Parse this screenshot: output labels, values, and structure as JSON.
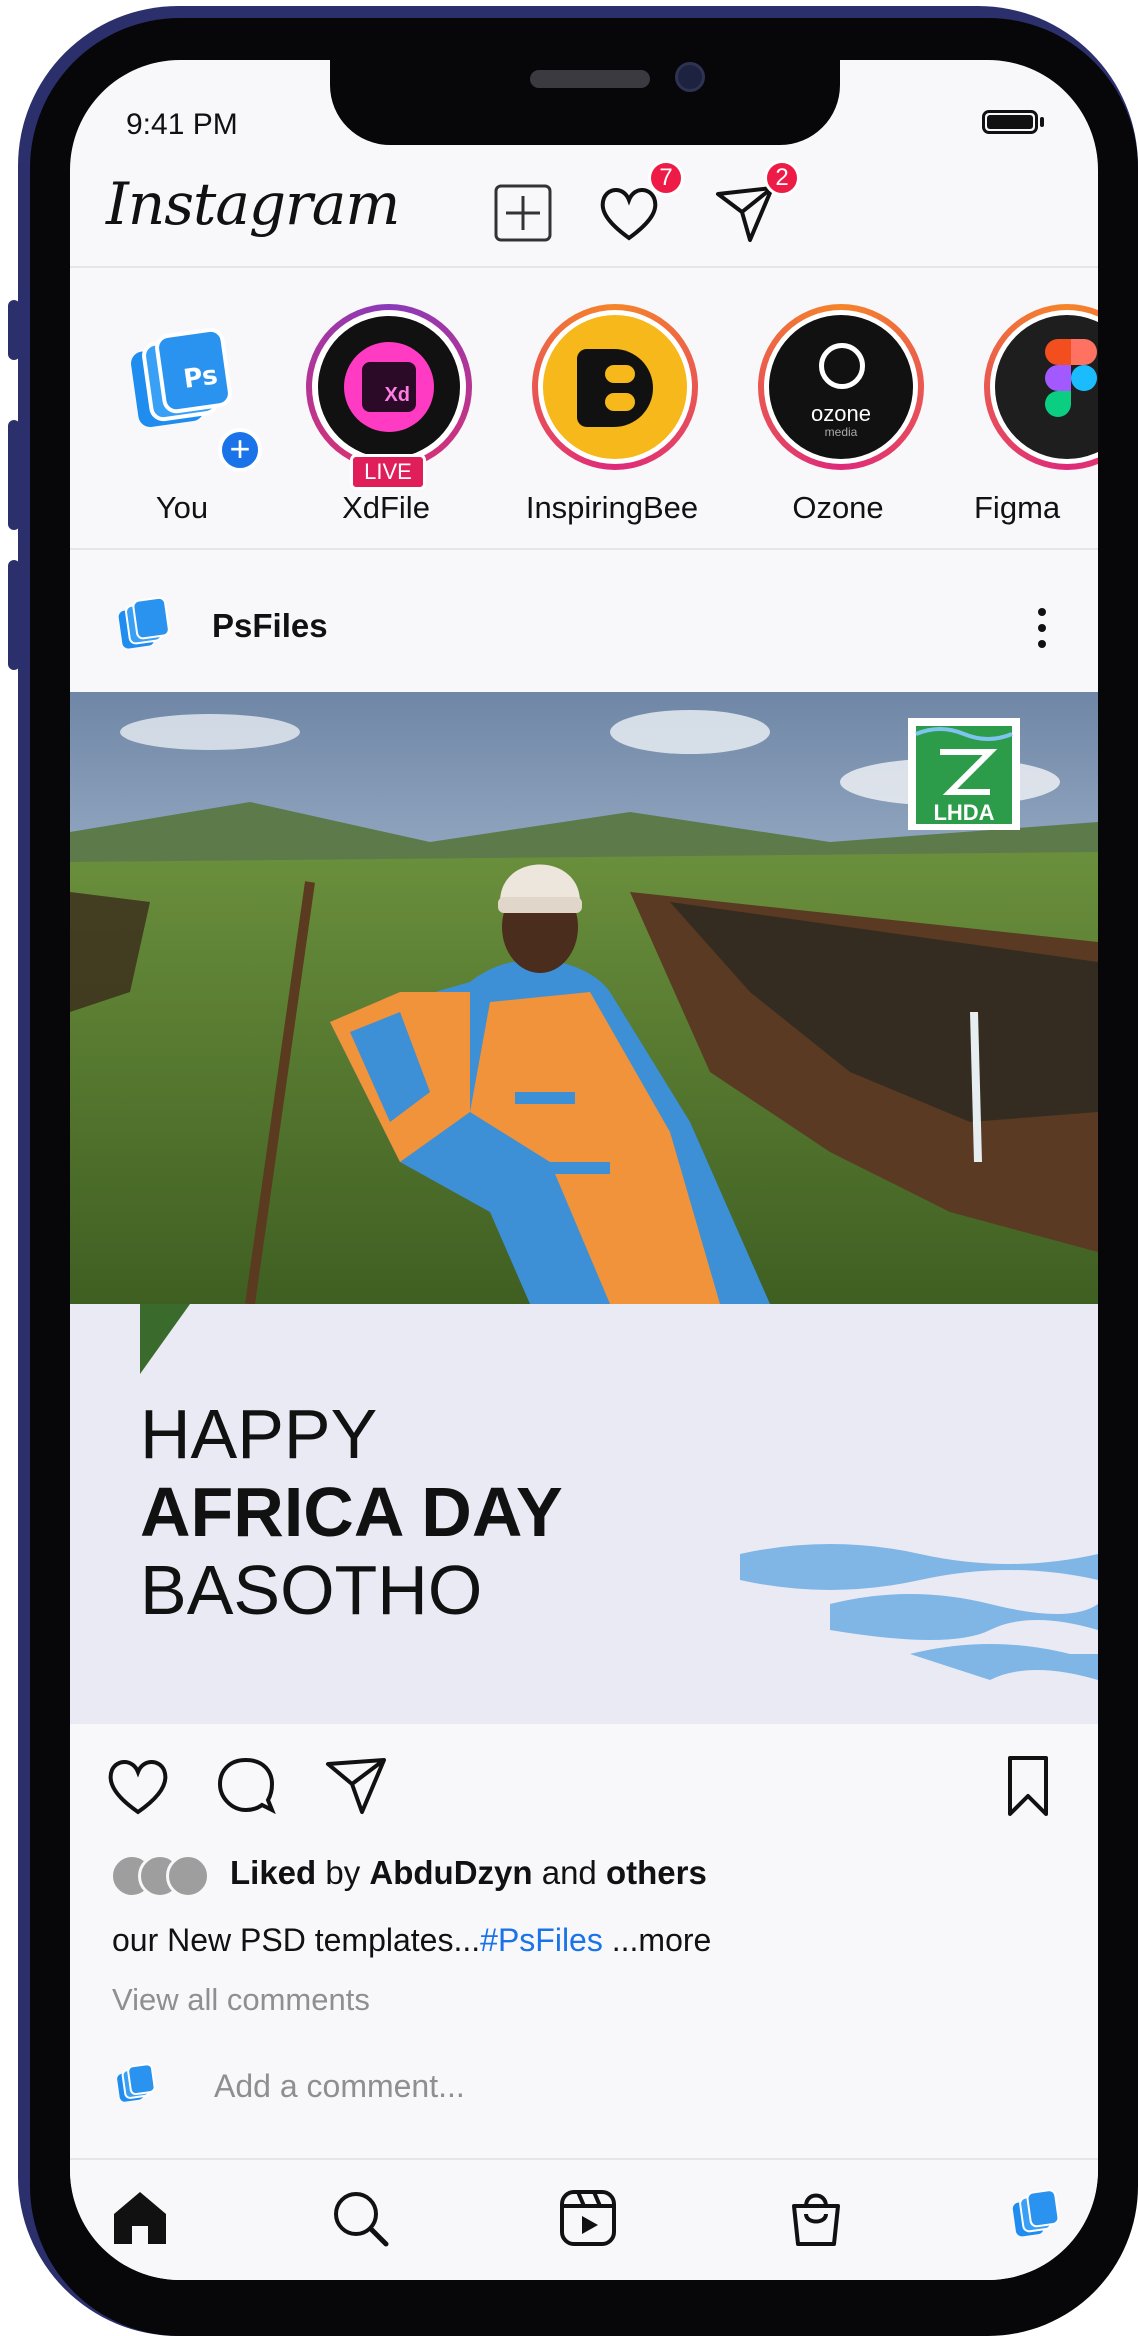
{
  "status_bar": {
    "time": "9:41 PM"
  },
  "header": {
    "logo_text": "Instagram",
    "likes_badge": "7",
    "messages_badge": "2"
  },
  "stories": [
    {
      "label": "You"
    },
    {
      "label": "XdFile",
      "live_tag": "LIVE"
    },
    {
      "label": "InspiringBee"
    },
    {
      "label": "Ozone",
      "logo_text": "ozone",
      "logo_sub": "media"
    },
    {
      "label": "Figma"
    }
  ],
  "post": {
    "username": "PsFiles",
    "photo_badge": "LHDA",
    "card_line1": "HAPPY",
    "card_line2": "AFRICA DAY",
    "card_line3": "BASOTHO",
    "liked_prefix": "Liked",
    "liked_by": " by ",
    "liked_user": "AbduDzyn",
    "liked_and": " and ",
    "liked_others": "others",
    "caption_text": "our New PSD templates...",
    "caption_tag": "#PsFiles",
    "caption_more": " ...more",
    "view_all": "View all comments",
    "add_comment_placeholder": "Add a comment..."
  },
  "colors": {
    "accent_blue": "#1a73e8",
    "badge_red": "#ee1b46",
    "card_bg": "#e9eaf3",
    "wave_blue": "#7fb6e6"
  }
}
